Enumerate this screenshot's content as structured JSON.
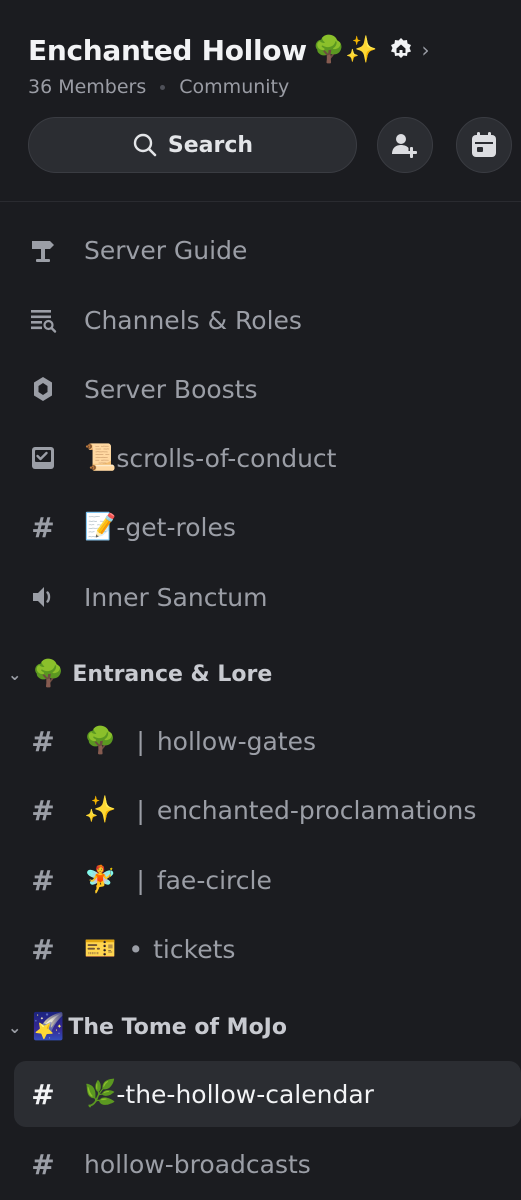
{
  "server": {
    "name": "Enchanted Hollow",
    "name_emoji": "🌳✨",
    "members": "36 Members",
    "type": "Community"
  },
  "toolbar": {
    "search_label": "Search",
    "invite_icon": "add-member-icon",
    "events_icon": "calendar-icon"
  },
  "top_items": [
    {
      "icon": "signpost-icon",
      "emoji": "",
      "label": "Server Guide"
    },
    {
      "icon": "channel-browse-icon",
      "emoji": "",
      "label": "Channels & Roles"
    },
    {
      "icon": "boost-icon",
      "emoji": "",
      "label": "Server Boosts"
    },
    {
      "icon": "rules-icon",
      "emoji": "📜",
      "label": "scrolls-of-conduct"
    },
    {
      "icon": "hash-icon",
      "emoji": "📝",
      "label": "-get-roles"
    },
    {
      "icon": "voice-icon",
      "emoji": "",
      "label": "Inner Sanctum"
    }
  ],
  "categories": [
    {
      "emoji": "🌳",
      "name": "Entrance & Lore",
      "channels": [
        {
          "emoji": "🌳",
          "sep": "|",
          "label": "hollow-gates"
        },
        {
          "emoji": "✨",
          "sep": "|",
          "label": "enchanted-proclamations"
        },
        {
          "emoji": "🧚",
          "sep": "|",
          "label": "fae-circle"
        },
        {
          "emoji": "🎫",
          "sep": "•",
          "label": "tickets"
        }
      ]
    },
    {
      "emoji": "🌠",
      "name": "The Tome of MoJo",
      "channels": [
        {
          "emoji": "🌿",
          "sep": "",
          "label": "-the-hollow-calendar",
          "selected": true
        },
        {
          "emoji": "",
          "sep": "",
          "label": "hollow-broadcasts"
        }
      ]
    }
  ],
  "colors": {
    "background": "#1b1c20",
    "selected_row": "#2b2d32",
    "muted_text": "#9b9ea6",
    "title_text": "#f2f3f5"
  }
}
